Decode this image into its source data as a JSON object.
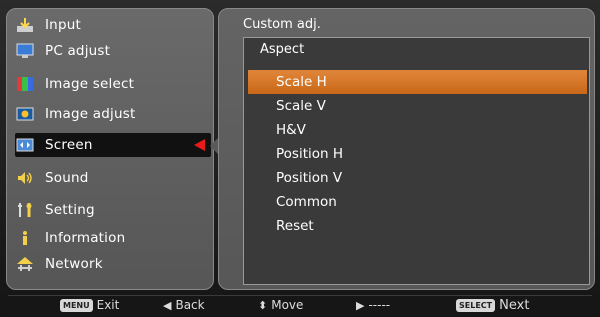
{
  "menu": {
    "items": [
      {
        "label": "Input",
        "icon": "input-icon"
      },
      {
        "label": "PC adjust",
        "icon": "pc-adjust-icon"
      },
      {
        "label": "Image select",
        "icon": "image-select-icon"
      },
      {
        "label": "Image adjust",
        "icon": "image-adjust-icon"
      },
      {
        "label": "Screen",
        "icon": "screen-icon",
        "active": true
      },
      {
        "label": "Sound",
        "icon": "sound-icon"
      },
      {
        "label": "Setting",
        "icon": "setting-icon"
      },
      {
        "label": "Information",
        "icon": "information-icon"
      },
      {
        "label": "Network",
        "icon": "network-icon"
      }
    ]
  },
  "submenu": {
    "title": "Custom adj.",
    "group_label": "Aspect",
    "options": [
      {
        "label": "Scale H",
        "selected": true
      },
      {
        "label": "Scale V"
      },
      {
        "label": "H&V"
      },
      {
        "label": "Position H"
      },
      {
        "label": "Position V"
      },
      {
        "label": "Common"
      },
      {
        "label": "Reset"
      }
    ]
  },
  "footer": {
    "exit_key": "MENU",
    "exit_label": "Exit",
    "back_label": "Back",
    "move_label": "Move",
    "right_label": "-----",
    "next_key": "SELECT",
    "next_label": "Next"
  },
  "colors": {
    "accent_selected": "#d9792a",
    "active_arrow": "#e81a1a"
  }
}
